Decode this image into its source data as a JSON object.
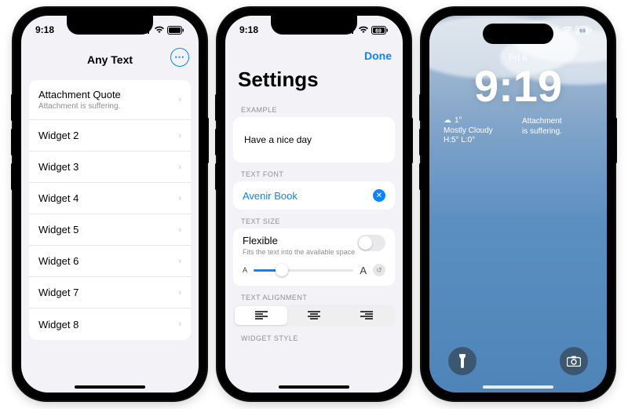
{
  "phone1": {
    "status_time": "9:18",
    "title": "Any Text",
    "rows": [
      {
        "title": "Attachment Quote",
        "subtitle": "Attachment is suffering."
      },
      {
        "title": "Widget 2"
      },
      {
        "title": "Widget 3"
      },
      {
        "title": "Widget 4"
      },
      {
        "title": "Widget 5"
      },
      {
        "title": "Widget 6"
      },
      {
        "title": "Widget 7"
      },
      {
        "title": "Widget 8"
      }
    ],
    "more_icon_glyph": "⋯"
  },
  "phone2": {
    "status_time": "9:18",
    "done_label": "Done",
    "title": "Settings",
    "section_example": "EXAMPLE",
    "example_text": "Have a nice day",
    "section_font": "TEXT FONT",
    "font_name": "Avenir Book",
    "section_size": "TEXT SIZE",
    "size_title": "Flexible",
    "size_subtitle": "Fits the text into the available space",
    "slider_small_label": "A",
    "slider_large_label": "A",
    "section_align": "TEXT ALIGNMENT",
    "align_options": {
      "left": "≡",
      "center": "≡",
      "right": "≡"
    },
    "align_selected_index": 0,
    "section_widget": "WIDGET STYLE",
    "toggle_on": false,
    "slider_value_pct": 28,
    "battery_text": "69"
  },
  "phone3": {
    "status_time": "",
    "date_label": "Fri 6",
    "time_label": "9:19",
    "weather": {
      "temp": "1°",
      "condition": "Mostly Cloudy",
      "hilo": "H:5° L:0°"
    },
    "quote_text": "Attachment\nis suffering.",
    "battery_text": "69"
  },
  "icons": {
    "signal": "signal-icon",
    "wifi": "wifi-icon",
    "battery": "battery-icon",
    "chevron": "›",
    "clear": "✕",
    "reset": "↺",
    "cloud": "☁",
    "flashlight": "flashlight-icon",
    "camera": "camera-icon"
  },
  "colors": {
    "accent": "#0a84ff"
  }
}
